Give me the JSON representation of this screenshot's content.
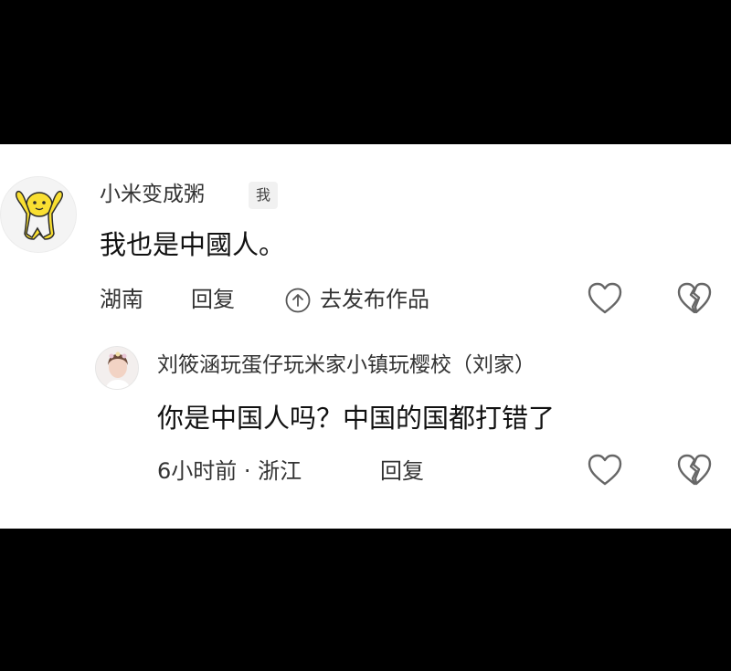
{
  "comment": {
    "username": "小米变成粥",
    "me_badge": "我",
    "text": "我也是中國人。",
    "location": "湖南",
    "reply_label": "回复",
    "post_label": "去发布作品",
    "like_icon": "heart-outline-icon",
    "dislike_icon": "broken-heart-icon"
  },
  "reply": {
    "username": "刘筱涵玩蛋仔玩米家小镇玩樱校（刘家）",
    "text": "你是中国人吗？中国的国都打错了",
    "meta": "6小时前 · 浙江",
    "reply_label": "回复",
    "like_icon": "heart-outline-icon",
    "dislike_icon": "broken-heart-icon"
  },
  "colors": {
    "background": "#000000",
    "panel": "#ffffff",
    "avatar_yellow": "#f9df32"
  }
}
